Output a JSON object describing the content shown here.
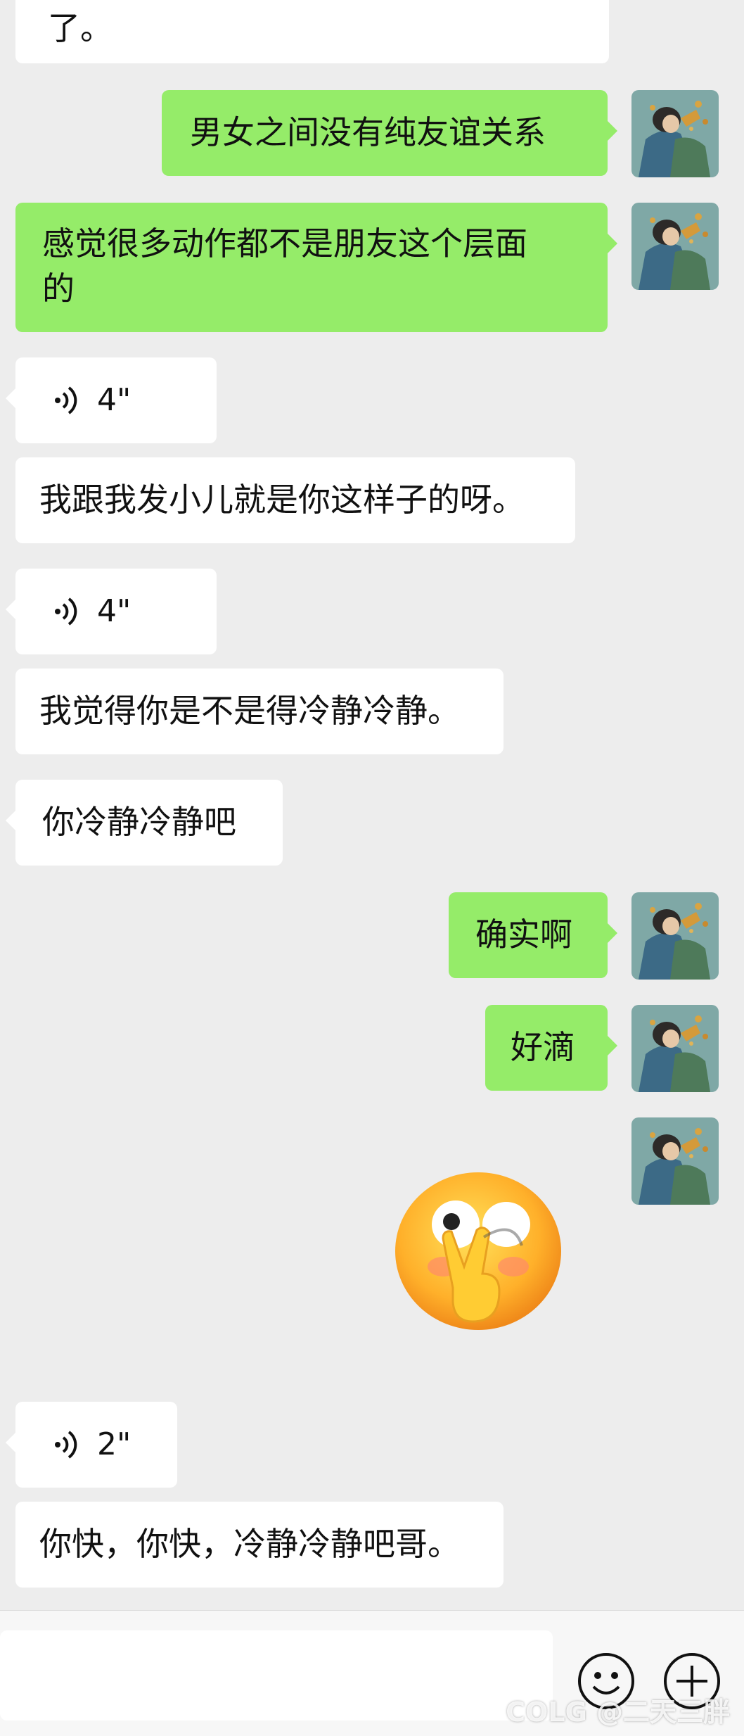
{
  "messages": {
    "m0": "了。",
    "m1": "男女之间没有纯友谊关系",
    "m2_line1": "感觉很多动作都不是朋友这个层面",
    "m2_line2": "的",
    "v1": "4\"",
    "m3": "我跟我发小儿就是你这样子的呀。",
    "v2": "4\"",
    "m4": "我觉得你是不是得冷静冷静。",
    "m5": "你冷静冷静吧",
    "m6": "确实啊",
    "m7": "好滴",
    "v3": "2\"",
    "m8": "你快，你快，冷静冷静吧哥。"
  },
  "input_bar": {
    "emoji_button": "smiley-icon",
    "plus_button": "plus-icon"
  },
  "watermark": "COLG @二天三胖",
  "colors": {
    "background": "#ededed",
    "received_bubble": "#ffffff",
    "sent_bubble": "#95ec69"
  }
}
